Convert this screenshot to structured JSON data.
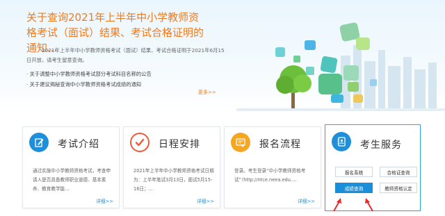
{
  "hero": {
    "title": "关于查询2021年上半年中小学教师资格考试（面试）结果、考试合格证明的通知...",
    "summary": "2021年上半年中小学教师资格考试（面试）结果、考试合格证明于2021年6月15日开放，请考生留意查询。",
    "links": [
      "关于调整中小学教师资格考试部分考试科目名称的公告",
      "关于建议揭秘查询中小学教师资格考试成绩的通知"
    ],
    "more": "更多>>"
  },
  "cards": [
    {
      "title": "考试介绍",
      "icon": "pencil-icon",
      "text": "通过实施中小学教师资格考试，考查申请人是否具备教师职业道德、基本素养、教育教学能...",
      "more": "详细>>"
    },
    {
      "title": "日程安排",
      "icon": "checkmark-icon",
      "text": "2021年上半年中小学教师资格考试日期为：上半年笔试3月13日，面试5月15-16日；...",
      "more": "详细>>"
    },
    {
      "title": "报名流程",
      "icon": "certificate-icon",
      "text": "登录。考生登录“中小学教师资格考试”（http://ntce.neea.edu....",
      "more": "详细>>"
    },
    {
      "title": "考生服务",
      "icon": "address-book-icon",
      "buttons": [
        "报名系统",
        "合格证查询",
        "成绩查询",
        "教师资格认定"
      ]
    }
  ],
  "colors": {
    "accent_orange": "#f07b1e",
    "accent_blue": "#1a8ed8",
    "highlight_border": "#2ea4e4",
    "annotation_red": "#e52b2b"
  }
}
